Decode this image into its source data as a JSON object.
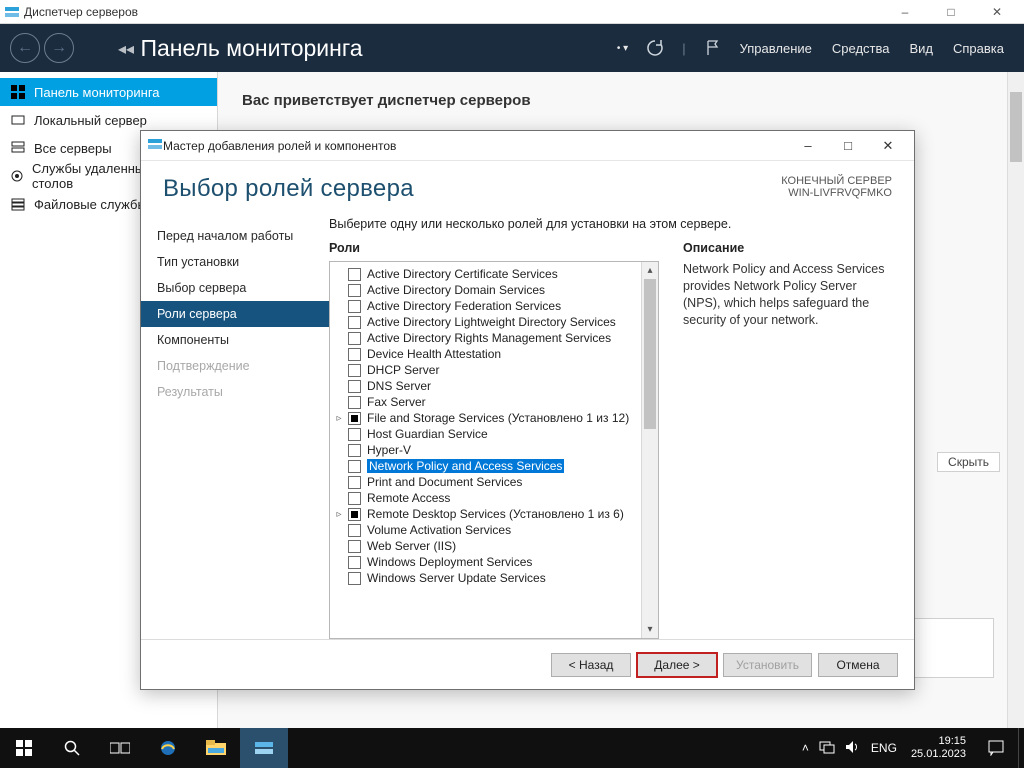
{
  "app_title": "Диспетчер серверов",
  "header": {
    "crumbs": "Панель мониторинга",
    "menu": [
      "Управление",
      "Средства",
      "Вид",
      "Справка"
    ]
  },
  "sidebar": {
    "items": [
      {
        "label": "Панель мониторинга",
        "icon": "dashboard"
      },
      {
        "label": "Локальный сервер",
        "icon": "local-server"
      },
      {
        "label": "Все серверы",
        "icon": "all-servers"
      },
      {
        "label": "Службы удаленных рабочих столов",
        "icon": "rds"
      },
      {
        "label": "Файловые службы",
        "icon": "file-services"
      }
    ],
    "active_index": 0
  },
  "main": {
    "welcome": "Вас приветствует диспетчер серверов",
    "hide_label": "Скрыть"
  },
  "wizard": {
    "title": "Мастер добавления ролей и компонентов",
    "heading": "Выбор ролей сервера",
    "target_label": "КОНЕЧНЫЙ СЕРВЕР",
    "target_host": "WIN-LIVFRVQFMKO",
    "steps": [
      {
        "label": "Перед началом работы",
        "state": "link"
      },
      {
        "label": "Тип установки",
        "state": "link"
      },
      {
        "label": "Выбор сервера",
        "state": "link"
      },
      {
        "label": "Роли сервера",
        "state": "active"
      },
      {
        "label": "Компоненты",
        "state": "link"
      },
      {
        "label": "Подтверждение",
        "state": "disabled"
      },
      {
        "label": "Результаты",
        "state": "disabled"
      }
    ],
    "instruction": "Выберите одну или несколько ролей для установки на этом сервере.",
    "roles_label": "Роли",
    "roles": [
      {
        "label": "Active Directory Certificate Services"
      },
      {
        "label": "Active Directory Domain Services"
      },
      {
        "label": "Active Directory Federation Services"
      },
      {
        "label": "Active Directory Lightweight Directory Services"
      },
      {
        "label": "Active Directory Rights Management Services"
      },
      {
        "label": "Device Health Attestation"
      },
      {
        "label": "DHCP Server"
      },
      {
        "label": "DNS Server"
      },
      {
        "label": "Fax Server"
      },
      {
        "label": "File and Storage Services (Установлено 1 из 12)",
        "partial": true,
        "expandable": true
      },
      {
        "label": "Host Guardian Service"
      },
      {
        "label": "Hyper-V"
      },
      {
        "label": "Network Policy and Access Services",
        "selected": true
      },
      {
        "label": "Print and Document Services"
      },
      {
        "label": "Remote Access"
      },
      {
        "label": "Remote Desktop Services (Установлено 1 из 6)",
        "partial": true,
        "expandable": true
      },
      {
        "label": "Volume Activation Services"
      },
      {
        "label": "Web Server (IIS)"
      },
      {
        "label": "Windows Deployment Services"
      },
      {
        "label": "Windows Server Update Services"
      }
    ],
    "desc_label": "Описание",
    "desc_text": "Network Policy and Access Services provides Network Policy Server (NPS), which helps safeguard the security of your network.",
    "buttons": {
      "back": "< Назад",
      "next": "Далее >",
      "install": "Установить",
      "cancel": "Отмена"
    }
  },
  "taskbar": {
    "lang": "ENG",
    "time": "19:15",
    "date": "25.01.2023"
  }
}
